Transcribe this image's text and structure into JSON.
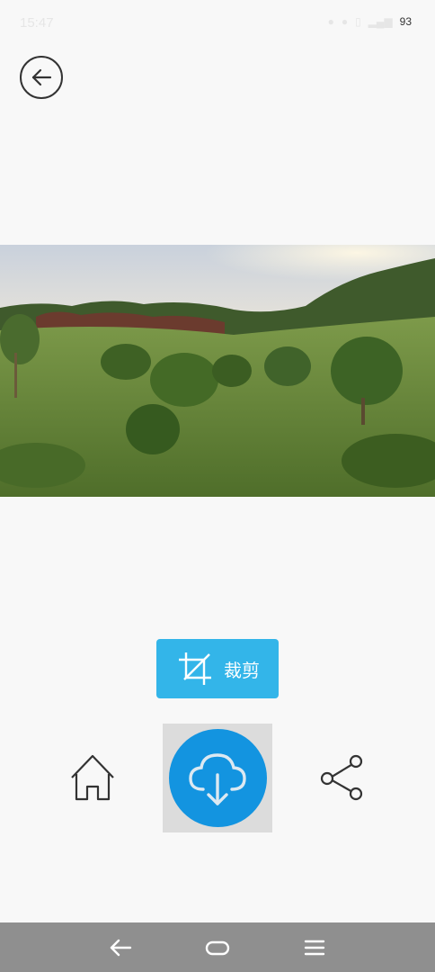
{
  "status_bar": {
    "time": "15:47",
    "battery": "93"
  },
  "toolbar": {
    "crop_label": "裁剪"
  },
  "icons": {
    "back": "back-arrow-circle-icon",
    "crop": "crop-icon",
    "home": "home-icon",
    "download": "cloud-download-icon",
    "share": "share-icon",
    "nav_back": "nav-back-icon",
    "nav_home": "nav-home-icon",
    "nav_menu": "nav-menu-icon"
  },
  "colors": {
    "accent": "#33b5e9",
    "download_bg": "#1394e0",
    "nav_bar": "#8f8f8f",
    "page_bg": "#f8f8f8"
  }
}
